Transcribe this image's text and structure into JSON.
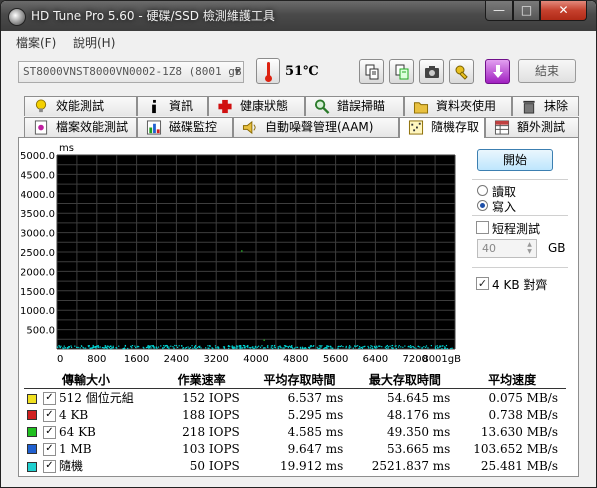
{
  "window": {
    "title": "HD Tune Pro 5.60 - 硬碟/SSD 檢測維護工具",
    "controls": {
      "minimize": "—",
      "maximize": "□",
      "close": "✕"
    }
  },
  "menu": {
    "items": [
      "檔案(F)",
      "說明(H)"
    ]
  },
  "toolbar": {
    "drive": "ST8000VNST8000VN0002-1Z8 (8001 gB",
    "temperature": "51℃",
    "exit_label": "結束"
  },
  "tabs": {
    "row1": [
      "效能測試",
      "資訊",
      "健康狀態",
      "錯誤掃瞄",
      "資料夾使用",
      "抹除"
    ],
    "row2": [
      "檔案效能測試",
      "磁碟監控",
      "自動噪聲管理(AAM)",
      "隨機存取",
      "額外測試"
    ],
    "active": "隨機存取"
  },
  "controls": {
    "start_label": "開始",
    "read_label": "讀取",
    "write_label": "寫入",
    "mode": "write",
    "short_test_label": "短程測試",
    "short_test_checked": false,
    "short_test_value": "40",
    "short_test_unit": "GB",
    "align_label": "4 KB 對齊",
    "align_checked": true
  },
  "chart_data": {
    "type": "scatter",
    "ylabel": "ms",
    "xlabel": "gB",
    "xlim": [
      0,
      8001
    ],
    "ylim": [
      0,
      5000
    ],
    "y_ticks": [
      "5000.0",
      "4500.0",
      "4000.0",
      "3500.0",
      "3000.0",
      "2500.0",
      "2000.0",
      "1500.0",
      "1000.0",
      "500.0"
    ],
    "x_ticks": [
      "0",
      "800",
      "1600",
      "2400",
      "3200",
      "4000",
      "4800",
      "5600",
      "6400",
      "7200",
      "8001gB"
    ],
    "grid": true,
    "background": "#000000",
    "grid_color": "#3d3d3d",
    "series": [
      {
        "name": "隨機",
        "color": "#00d8d8",
        "y_band": [
          0,
          80
        ],
        "outliers": [
          {
            "x": 3700,
            "y": 2520
          },
          {
            "x": 4150,
            "y": 220
          }
        ]
      }
    ]
  },
  "results": {
    "headers": [
      "傳輸大小",
      "作業速率",
      "平均存取時間",
      "最大存取時間",
      "平均速度"
    ],
    "rows": [
      {
        "color": "#f0e020",
        "size": "512 個位元組",
        "rate": "152 IOPS",
        "avg_time": "6.537 ms",
        "max_time": "54.645 ms",
        "speed": "0.075 MB/s"
      },
      {
        "color": "#d02020",
        "size": "4 KB",
        "rate": "188 IOPS",
        "avg_time": "5.295 ms",
        "max_time": "48.176 ms",
        "speed": "0.738 MB/s"
      },
      {
        "color": "#20c020",
        "size": "64 KB",
        "rate": "218 IOPS",
        "avg_time": "4.585 ms",
        "max_time": "49.350 ms",
        "speed": "13.630 MB/s"
      },
      {
        "color": "#2060d0",
        "size": "1 MB",
        "rate": "103 IOPS",
        "avg_time": "9.647 ms",
        "max_time": "53.665 ms",
        "speed": "103.652 MB/s"
      },
      {
        "color": "#20d0d0",
        "size": "隨機",
        "rate": "50 IOPS",
        "avg_time": "19.912 ms",
        "max_time": "2521.837 ms",
        "speed": "25.481 MB/s"
      }
    ],
    "row_checked": "✓"
  }
}
